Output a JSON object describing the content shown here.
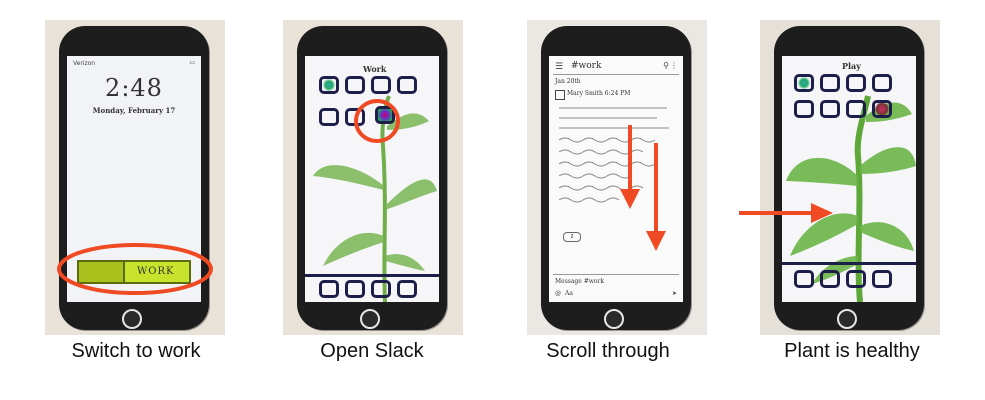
{
  "panels": [
    {
      "caption": "Switch to work",
      "status": "Verizon",
      "time": "2:48",
      "date": "Monday, February 17",
      "toggle_label": "WORK"
    },
    {
      "caption": "Open Slack",
      "label": "Work"
    },
    {
      "caption": "Scroll through",
      "channel": "#work",
      "date": "Jan 20th",
      "author": "Mary Smith 6:24 PM",
      "input_placeholder": "Message #work",
      "reaction": "2",
      "footer": "Aa"
    },
    {
      "caption": "Plant is healthy",
      "label": "Play"
    }
  ],
  "colors": {
    "annotation": "#f04a24",
    "phone": "#1d1d1d",
    "toggle": "#c8e32b",
    "plant": "#6fae4a",
    "icon_outline": "#1d1f4a"
  }
}
